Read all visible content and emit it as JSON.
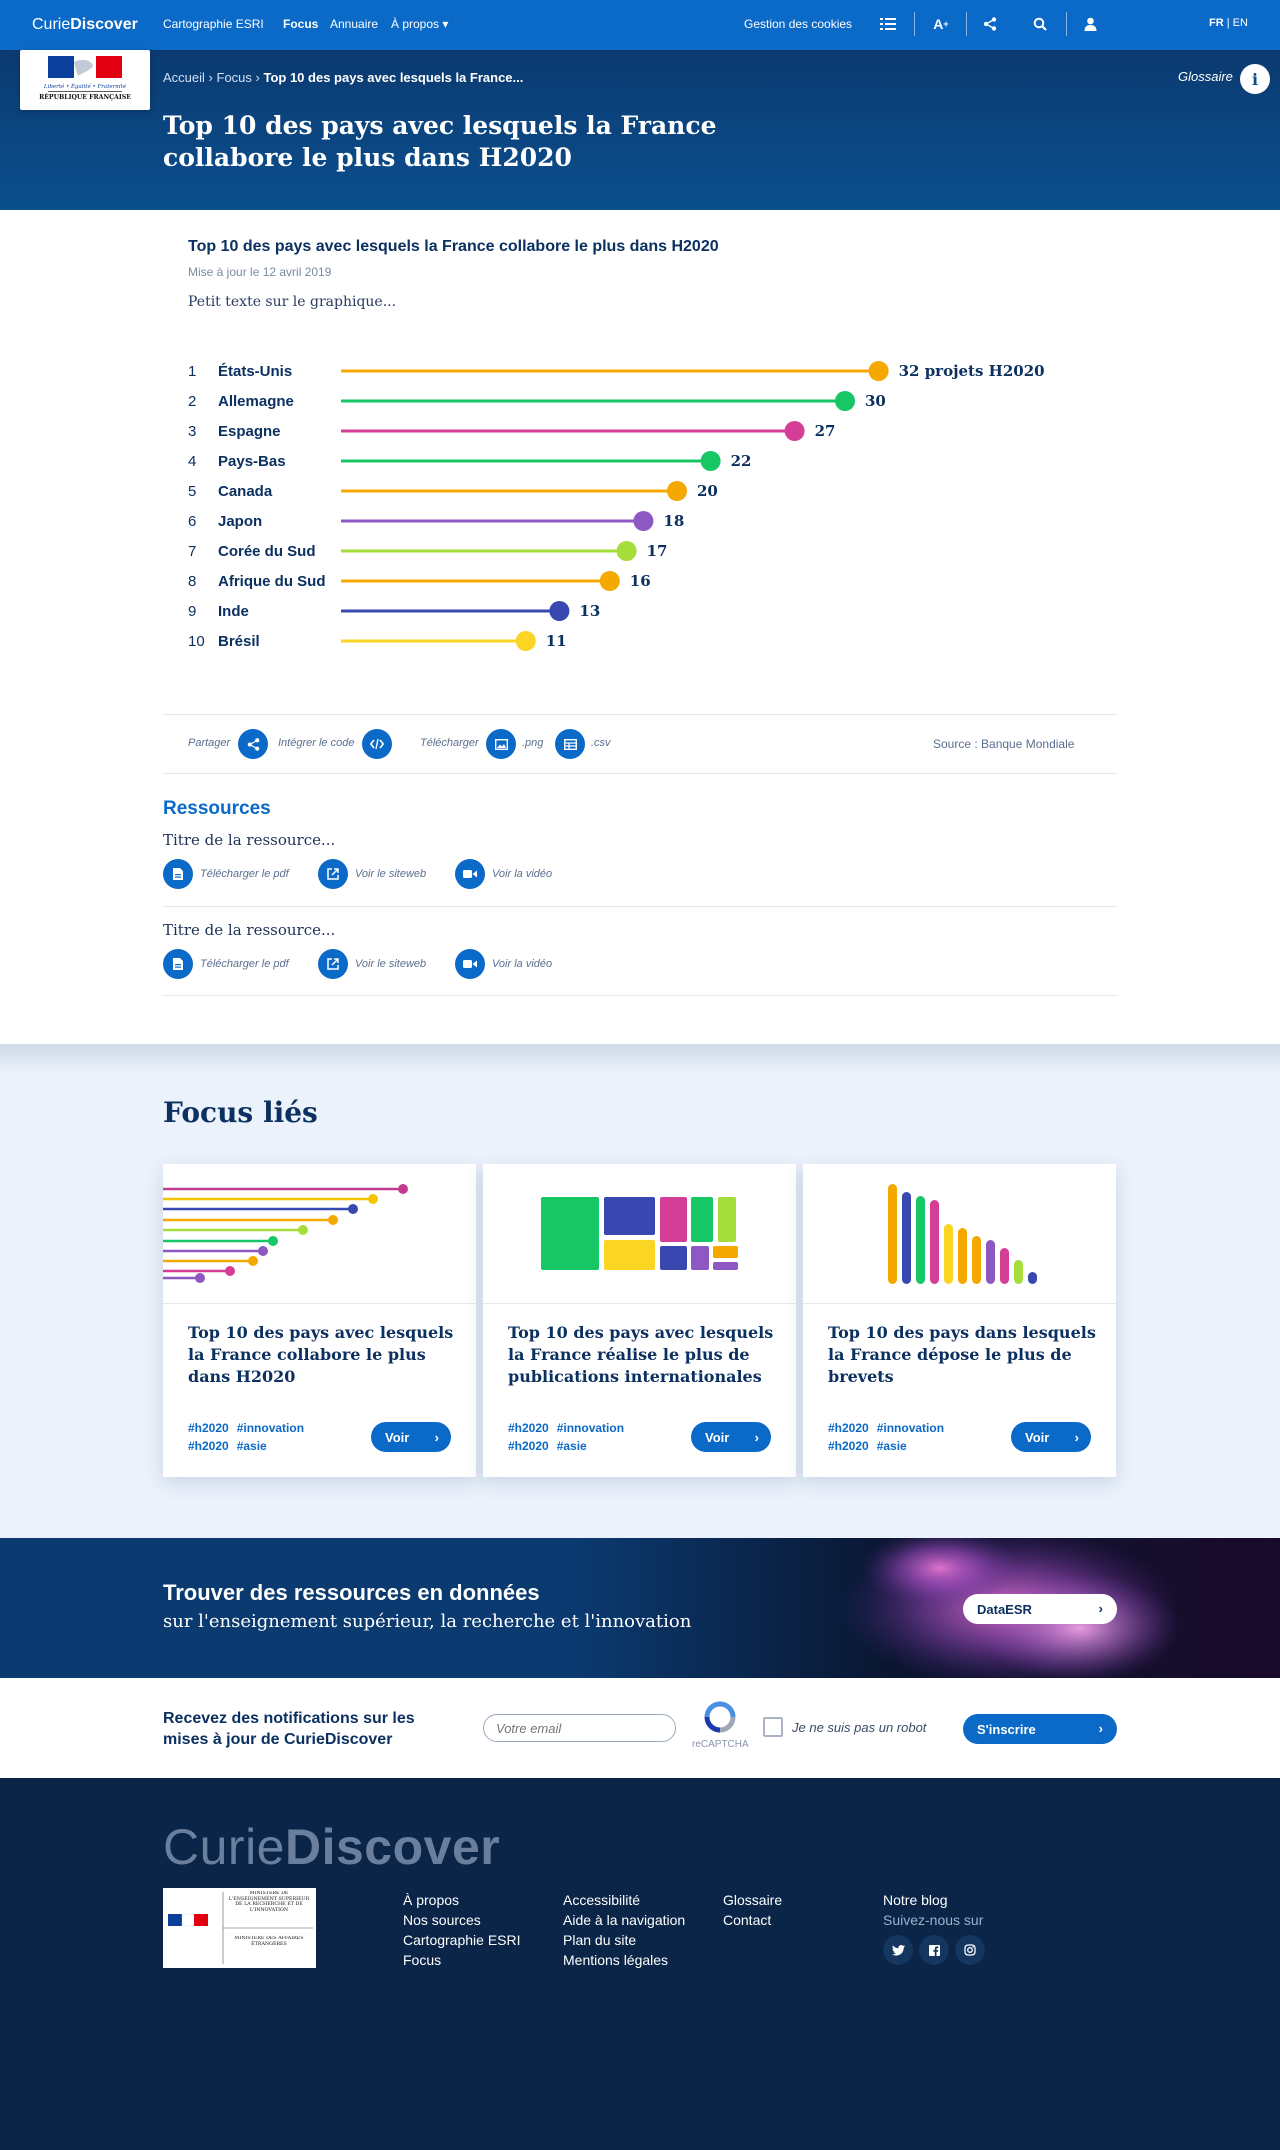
{
  "nav": {
    "brand_light": "Curie",
    "brand_bold": "Discover",
    "links": [
      "Cartographie ESRI",
      "Focus",
      "Annuaire",
      "À propos"
    ],
    "cookies": "Gestion des cookies",
    "lang_fr": "FR",
    "lang_sep": "|",
    "lang_en": "EN"
  },
  "hero": {
    "logo_text": "RÉPUBLIQUE FRANÇAISE",
    "logo_motto": "Liberté • Égalité • Fraternité",
    "breadcrumb": [
      "Accueil",
      "Focus",
      "Top 10 des pays avec lesquels la France..."
    ],
    "glossary": "Glossaire",
    "glossary_icon_glyph": "i",
    "title": "Top 10 des pays avec lesquels la France collabore le plus dans H2020"
  },
  "chart_section": {
    "title": "Top 10 des pays avec lesquels la France collabore le plus dans H2020",
    "updated": "Mise à jour le 12 avril 2019",
    "note": "Petit texte sur le graphique...",
    "first_value_suffix": " projets H2020"
  },
  "chart_data": {
    "type": "bar",
    "style": "lollipop-horizontal",
    "categories": [
      "États-Unis",
      "Allemagne",
      "Espagne",
      "Pays-Bas",
      "Canada",
      "Japon",
      "Corée du Sud",
      "Afrique du Sud",
      "Inde",
      "Brésil"
    ],
    "ranks": [
      "1",
      "2",
      "3",
      "4",
      "5",
      "6",
      "7",
      "8",
      "9",
      "10"
    ],
    "values": [
      32,
      30,
      27,
      22,
      20,
      18,
      17,
      16,
      13,
      11
    ],
    "colors": [
      "#f5a800",
      "#17c765",
      "#d43e96",
      "#17c765",
      "#f5a800",
      "#8e58c2",
      "#a5dd3a",
      "#f5a800",
      "#3848b0",
      "#fad524"
    ],
    "grid": false
  },
  "share": {
    "share_label": "Partager",
    "embed_label": "Intégrer le code",
    "download_label": "Télécharger",
    "png_label": ".png",
    "csv_label": ".csv",
    "source": "Source : Banque Mondiale"
  },
  "resources": {
    "title": "Ressources",
    "items": [
      {
        "name": "Titre de la ressource...",
        "pdf": "Télécharger le pdf",
        "site": "Voir le siteweb",
        "video": "Voir la vidéo"
      },
      {
        "name": "Titre de la ressource...",
        "pdf": "Télécharger le pdf",
        "site": "Voir le siteweb",
        "video": "Voir la vidéo"
      }
    ]
  },
  "related": {
    "title": "Focus liés",
    "cards": [
      {
        "title": "Top 10 des pays avec lesquels la France collabore le plus dans H2020",
        "tags": [
          "#h2020",
          "#innovation",
          "#h2020",
          "#asie"
        ],
        "button": "Voir"
      },
      {
        "title": "Top 10 des pays avec lesquels la France réalise le plus de publications internationales",
        "tags": [
          "#h2020",
          "#innovation",
          "#h2020",
          "#asie"
        ],
        "button": "Voir"
      },
      {
        "title": "Top 10 des pays dans lesquels la France dépose le plus de brevets",
        "tags": [
          "#h2020",
          "#innovation",
          "#h2020",
          "#asie"
        ],
        "button": "Voir"
      }
    ]
  },
  "banner": {
    "heading": "Trouver des ressources en données",
    "subheading": "sur l'enseignement supérieur, la recherche et l'innovation",
    "button": "DataESR"
  },
  "newsletter": {
    "text": "Recevez des notifications sur les mises à jour de CurieDiscover",
    "email_placeholder": "Votre email",
    "recaptcha": "reCAPTCHA",
    "robot": "Je ne suis pas un robot",
    "button": "S'inscrire"
  },
  "footer": {
    "brand_light": "Curie",
    "brand_bold": "Discover",
    "logo_ministry_1": "MINISTÈRE DE L'ENSEIGNEMENT SUPÉRIEUR DE LA RECHERCHE ET DE L'INNOVATION",
    "logo_ministry_2": "MINISTÈRE DES AFFAIRES ÉTRANGÈRES",
    "col1": [
      "À propos",
      "Nos sources",
      "Cartographie ESRI",
      "Focus"
    ],
    "col2": [
      "Accessibilité",
      "Aide à la navigation",
      "Plan du site",
      "Mentions légales"
    ],
    "col3": [
      "Glossaire",
      "Contact"
    ],
    "col4_blog": "Notre blog",
    "col4_follow": "Suivez-nous sur"
  },
  "colors": {
    "primary": "#0b69c7",
    "navy": "#0c3060",
    "footer": "#0a2547"
  }
}
